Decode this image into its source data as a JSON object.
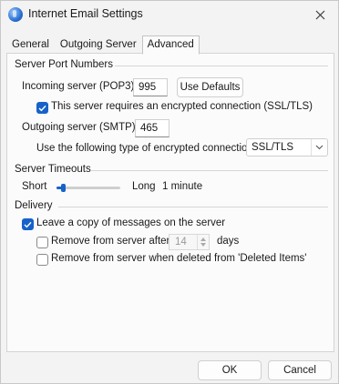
{
  "window": {
    "title": "Internet Email Settings"
  },
  "tabs": [
    {
      "label": "General"
    },
    {
      "label": "Outgoing Server"
    },
    {
      "label": "Advanced"
    }
  ],
  "server_ports": {
    "group_title": "Server Port Numbers",
    "incoming_label": "Incoming server (POP3):",
    "incoming_value": "995",
    "use_defaults_label": "Use Defaults",
    "encrypted_label": "This server requires an encrypted connection (SSL/TLS)",
    "encrypted_checked": true,
    "outgoing_label": "Outgoing server (SMTP):",
    "outgoing_value": "465",
    "encryption_type_label": "Use the following type of encrypted connection:",
    "encryption_type_value": "SSL/TLS"
  },
  "timeouts": {
    "group_title": "Server Timeouts",
    "short_label": "Short",
    "long_label": "Long",
    "value_label": "1 minute",
    "slider_fraction": 0.1
  },
  "delivery": {
    "group_title": "Delivery",
    "leave_copy_label": "Leave a copy of messages on the server",
    "leave_copy_checked": true,
    "remove_after_label": "Remove from server after",
    "remove_after_checked": false,
    "remove_after_days": "14",
    "days_label": "days",
    "remove_deleted_label": "Remove from server when deleted from 'Deleted Items'",
    "remove_deleted_checked": false
  },
  "footer": {
    "ok_label": "OK",
    "cancel_label": "Cancel"
  },
  "colors": {
    "accent": "#1762c9",
    "background": "#f3f3f3",
    "panel": "#fbfbfb"
  }
}
